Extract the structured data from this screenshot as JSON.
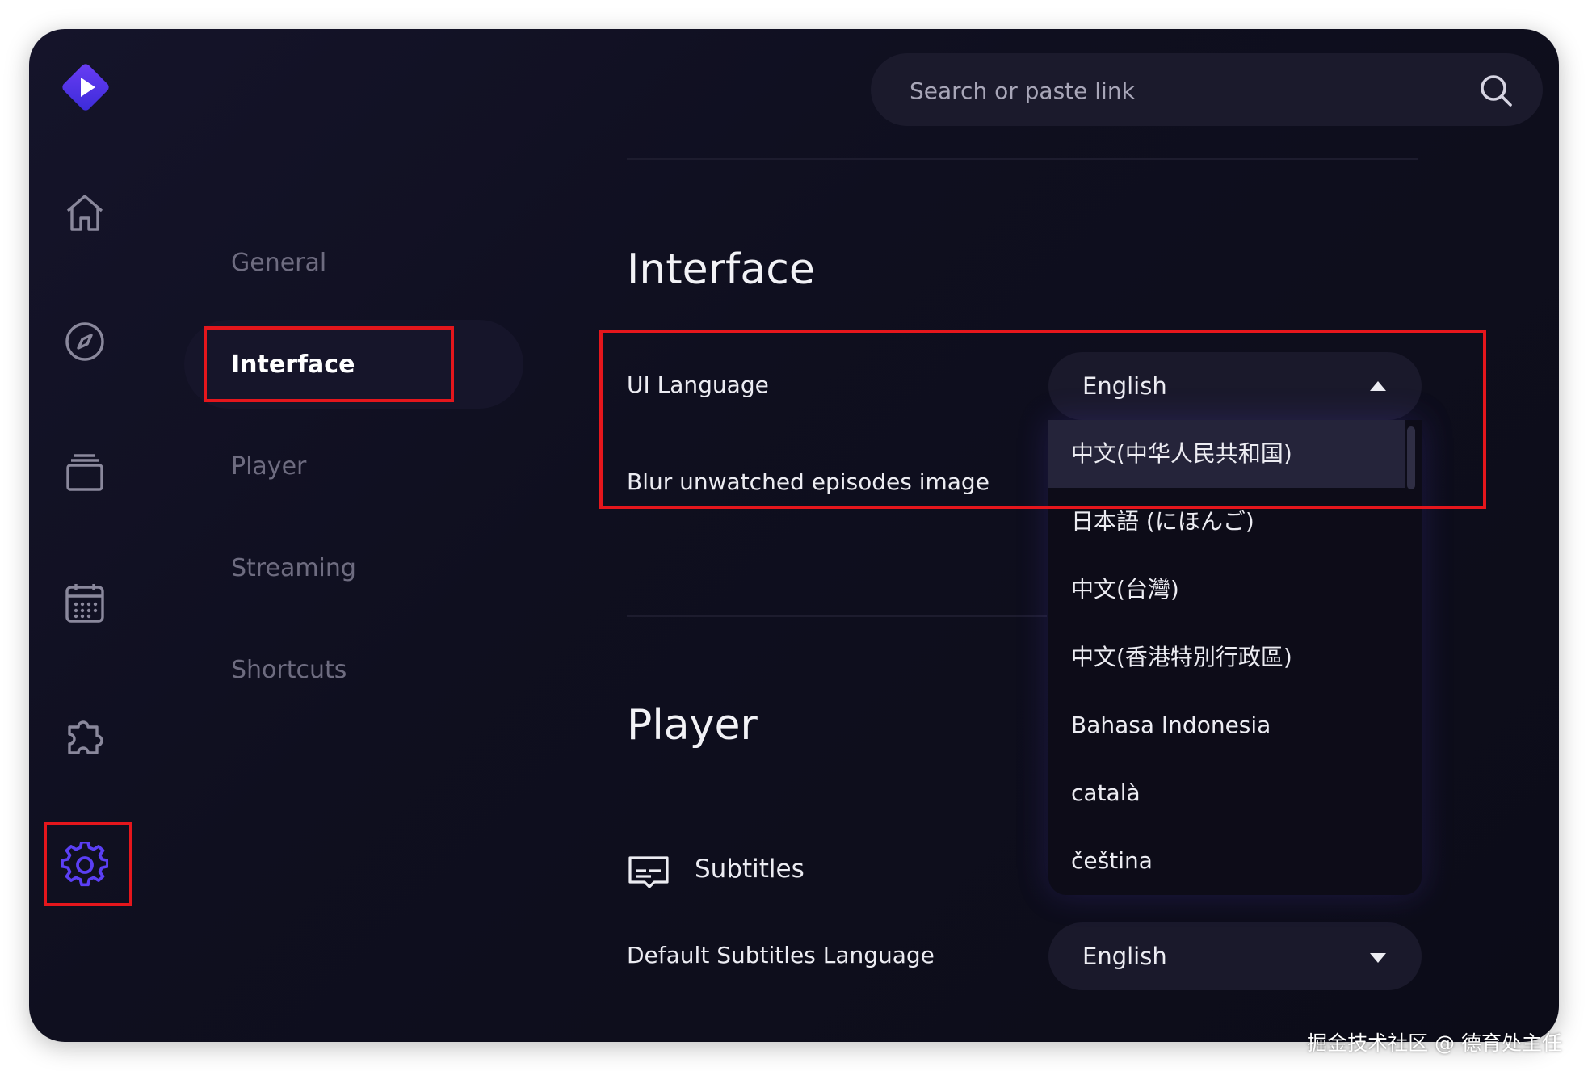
{
  "search": {
    "placeholder": "Search or paste link"
  },
  "rail": {
    "icons": [
      "home-icon",
      "compass-icon",
      "library-icon",
      "calendar-icon",
      "addons-icon",
      "settings-icon"
    ],
    "active": "settings-icon",
    "accent": "#5b3ff5"
  },
  "settings_menu": {
    "items": [
      {
        "label": "General"
      },
      {
        "label": "Interface"
      },
      {
        "label": "Player"
      },
      {
        "label": "Streaming"
      },
      {
        "label": "Shortcuts"
      }
    ],
    "active_label": "Interface"
  },
  "interface_section": {
    "title": "Interface",
    "ui_language_label": "UI Language",
    "ui_language_value": "English",
    "blur_label": "Blur unwatched episodes image",
    "language_options": [
      "中文(中华人民共和国)",
      "日本語 (にほんご)",
      "中文(台灣)",
      "中文(香港特別行政區)",
      "Bahasa Indonesia",
      "català",
      "čeština"
    ]
  },
  "player_section": {
    "title": "Player",
    "subtitles_label": "Subtitles",
    "default_subtitles_label": "Default Subtitles Language",
    "default_subtitles_value": "English"
  },
  "colors": {
    "annotation_red": "#e5161c",
    "background": "#0f0f1f"
  },
  "watermark": "掘金技术社区 @ 德育处主任"
}
